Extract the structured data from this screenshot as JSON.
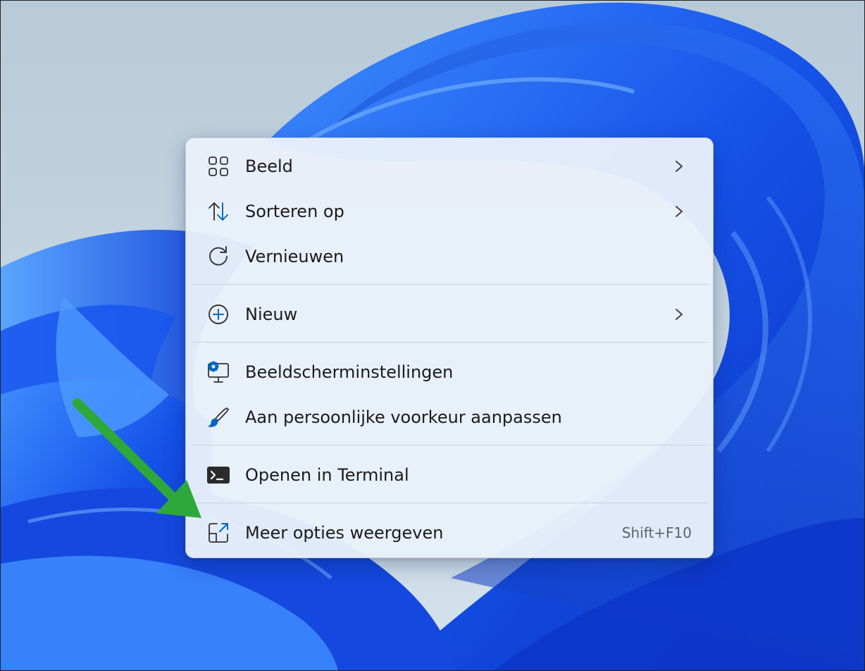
{
  "context_menu": {
    "items": [
      {
        "label": "Beeld",
        "icon": "grid-view-icon",
        "submenu": true
      },
      {
        "label": "Sorteren op",
        "icon": "sort-arrows-icon",
        "submenu": true
      },
      {
        "label": "Vernieuwen",
        "icon": "refresh-icon",
        "submenu": false
      },
      {
        "label": "Nieuw",
        "icon": "add-circle-icon",
        "submenu": true
      },
      {
        "label": "Beeldscherminstellingen",
        "icon": "display-settings-icon",
        "submenu": false
      },
      {
        "label": "Aan persoonlijke voorkeur aanpassen",
        "icon": "paintbrush-icon",
        "submenu": false
      },
      {
        "label": "Openen in Terminal",
        "icon": "terminal-icon",
        "submenu": false
      },
      {
        "label": "Meer opties weergeven",
        "icon": "open-in-new-window-icon",
        "submenu": false,
        "shortcut": "Shift+F10"
      }
    ]
  },
  "colors": {
    "accent": "#0067c0",
    "annotation_arrow": "#2ea83a",
    "wallpaper_blue": "#1a5cf0"
  }
}
